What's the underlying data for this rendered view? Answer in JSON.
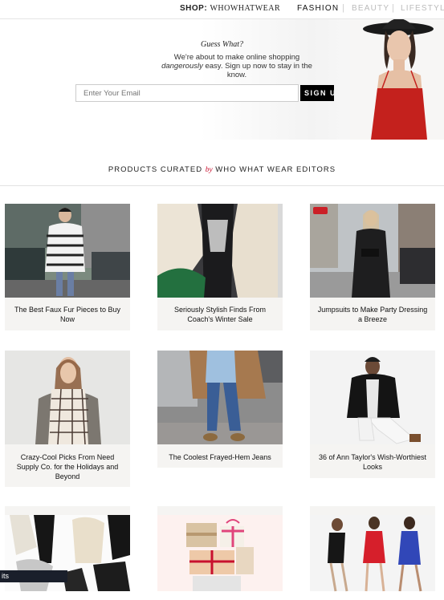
{
  "header": {
    "brand_shop": "SHOP:",
    "brand_name": "WHOWHATWEAR",
    "nav": [
      {
        "label": "FASHION",
        "active": true
      },
      {
        "label": "BEAUTY",
        "active": false
      },
      {
        "label": "LIFESTYLE",
        "active": false
      }
    ],
    "separator": "|"
  },
  "hero": {
    "title": "Guess What?",
    "line1": "We're about to make online shopping",
    "line2_italic": "dangerously",
    "line2_rest": " easy. Sign up now to stay in the know.",
    "email_placeholder": "Enter Your Email",
    "signup_label": "SIGN UP"
  },
  "section": {
    "title_pre": "PRODUCTS CURATED ",
    "title_by": "by",
    "title_post": " WHO WHAT WEAR EDITORS"
  },
  "cards": [
    {
      "caption": "The Best Faux Fur Pieces to Buy Now"
    },
    {
      "caption": "Seriously Stylish Finds From Coach's Winter Sale"
    },
    {
      "caption": "Jumpsuits to Make Party Dressing a Breeze"
    },
    {
      "caption": "Crazy-Cool Picks From Need Supply Co. for the Holidays and Beyond"
    },
    {
      "caption": "The Coolest Frayed-Hem Jeans"
    },
    {
      "caption": "36 of Ann Taylor's Wish-Worthiest Looks"
    }
  ],
  "corner_tag": "its",
  "colors": {
    "accent_red": "#c8102e",
    "button_black": "#000000",
    "card_bg": "#f5f4f2"
  }
}
